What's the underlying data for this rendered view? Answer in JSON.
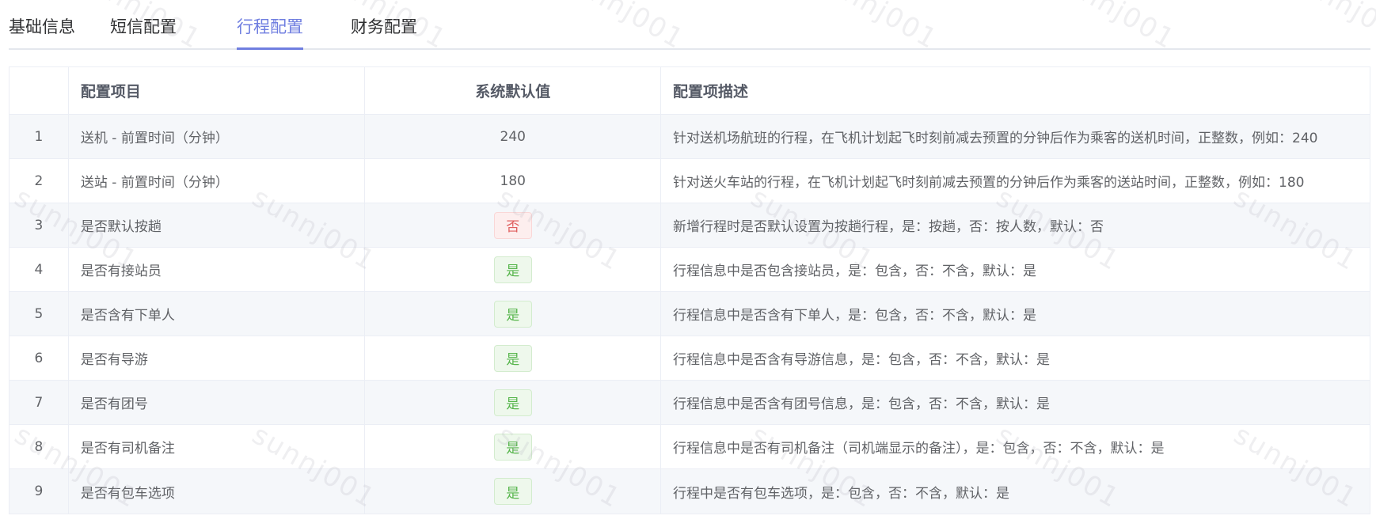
{
  "tabs": [
    {
      "label": "基础信息",
      "active": false
    },
    {
      "label": "短信配置",
      "active": false
    },
    {
      "label": "行程配置",
      "active": true
    },
    {
      "label": "财务配置",
      "active": false
    }
  ],
  "table": {
    "headers": {
      "index": "",
      "name": "配置项目",
      "value": "系统默认值",
      "desc": "配置项描述"
    },
    "rows": [
      {
        "index": "1",
        "name": "送机 - 前置时间（分钟）",
        "value": "240",
        "value_type": "text",
        "desc": "针对送机场航班的行程，在飞机计划起飞时刻前减去预置的分钟后作为乘客的送机时间，正整数，例如：240"
      },
      {
        "index": "2",
        "name": "送站 - 前置时间（分钟）",
        "value": "180",
        "value_type": "text",
        "desc": "针对送火车站的行程，在飞机计划起飞时刻前减去预置的分钟后作为乘客的送站时间，正整数，例如：180"
      },
      {
        "index": "3",
        "name": "是否默认按趟",
        "value": "否",
        "value_type": "tag-no",
        "desc": "新增行程时是否默认设置为按趟行程，是：按趟，否：按人数，默认：否"
      },
      {
        "index": "4",
        "name": "是否有接站员",
        "value": "是",
        "value_type": "tag-yes",
        "desc": "行程信息中是否包含接站员，是：包含，否：不含，默认：是"
      },
      {
        "index": "5",
        "name": "是否含有下单人",
        "value": "是",
        "value_type": "tag-yes",
        "desc": "行程信息中是否含有下单人，是：包含，否：不含，默认：是"
      },
      {
        "index": "6",
        "name": "是否有导游",
        "value": "是",
        "value_type": "tag-yes",
        "desc": "行程信息中是否含有导游信息，是：包含，否：不含，默认：是"
      },
      {
        "index": "7",
        "name": "是否有团号",
        "value": "是",
        "value_type": "tag-yes",
        "desc": "行程信息中是否含有团号信息，是：包含，否：不含，默认：是"
      },
      {
        "index": "8",
        "name": "是否有司机备注",
        "value": "是",
        "value_type": "tag-yes",
        "desc": "行程信息中是否有司机备注（司机端显示的备注），是：包含，否：不含，默认：是"
      },
      {
        "index": "9",
        "name": "是否有包车选项",
        "value": "是",
        "value_type": "tag-yes",
        "desc": "行程中是否有包车选项，是：包含，否：不含，默认：是"
      }
    ]
  },
  "watermark": "sunnj001",
  "colors": {
    "tab_active": "#6f7ee0",
    "tag_no": "#e06060",
    "tag_yes": "#56b54b"
  }
}
